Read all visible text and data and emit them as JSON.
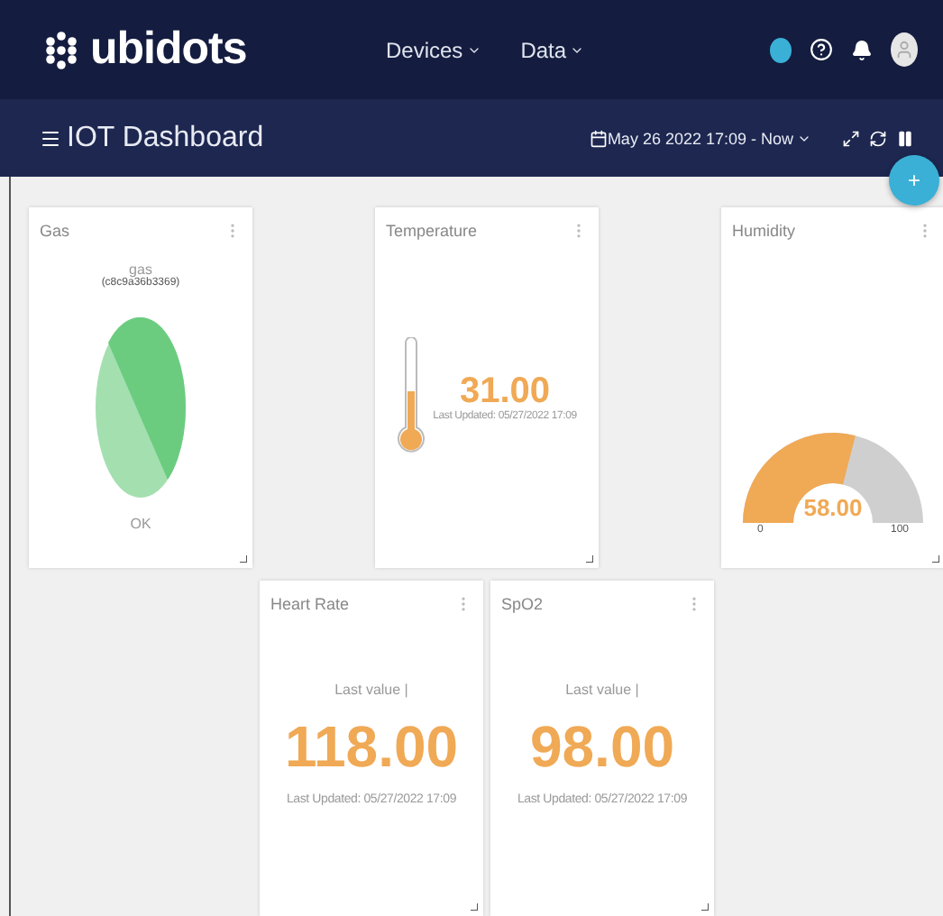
{
  "navbar": {
    "logo": "ubidots",
    "menus": [
      {
        "label": "Devices"
      },
      {
        "label": "Data"
      }
    ]
  },
  "dashboard": {
    "title": "IOT Dashboard",
    "date_range": "May 26 2022 17:09 - Now",
    "add_button": "+"
  },
  "widgets": [
    {
      "kind": "pie",
      "title": "Gas",
      "variable": "gas",
      "device": "(c8c9a36b3369)",
      "status": "OK"
    },
    {
      "kind": "thermometer",
      "title": "Temperature",
      "value": "31.00",
      "updated": "Last Updated: 05/27/2022 17:09"
    },
    {
      "kind": "gauge",
      "title": "Humidity",
      "value": "58.00",
      "level": 0.58,
      "min": "0",
      "max": "100"
    },
    {
      "kind": "metric",
      "title": "Heart Rate",
      "caption": "Last value |",
      "value": "118.00",
      "updated": "Last Updated: 05/27/2022 17:09"
    },
    {
      "kind": "metric",
      "title": "SpO2",
      "caption": "Last value |",
      "value": "98.00",
      "updated": "Last Updated: 05/27/2022 17:09"
    }
  ]
}
